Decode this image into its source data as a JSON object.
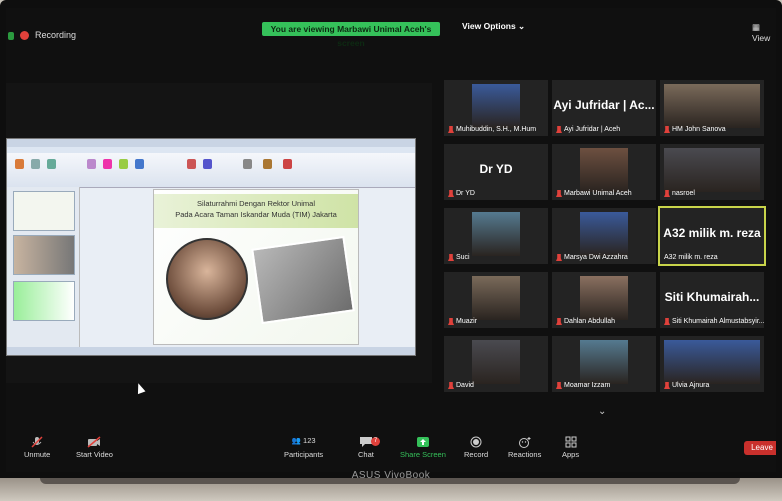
{
  "topbar": {
    "recording": "Recording",
    "banner": "You are viewing Marbawi Unimal Aceh's screen",
    "view_options": "View Options ⌄",
    "view": "View"
  },
  "slide": {
    "line1": "Silaturrahmi Dengan Rektor Unimal",
    "line2": "Pada Acara Taman Iskandar Muda (TIM) Jakarta"
  },
  "gallery": [
    {
      "name": "Muhibuddin, S.H., M.Hum",
      "type": "video"
    },
    {
      "name": "Ayi Jufridar | Aceh",
      "type": "name",
      "big": "Ayi Jufridar | Ac..."
    },
    {
      "name": "HM John Sanova",
      "type": "video"
    },
    {
      "name": "Dr YD",
      "type": "name",
      "big": "Dr YD"
    },
    {
      "name": "Marbawi Unimal Aceh",
      "type": "video"
    },
    {
      "name": "nasroel",
      "type": "video"
    },
    {
      "name": "Suci",
      "type": "video"
    },
    {
      "name": "Marsya Dwi Azzahra",
      "type": "video"
    },
    {
      "name": "A32 milik m. reza",
      "type": "name",
      "big": "A32 milik m. reza"
    },
    {
      "name": "Muazir",
      "type": "video"
    },
    {
      "name": "Dahlan Abdullah",
      "type": "video"
    },
    {
      "name": "Siti Khumairah Almustabsyir...",
      "type": "name",
      "big": "Siti Khumairah..."
    },
    {
      "name": "David",
      "type": "video"
    },
    {
      "name": "Moamar Izzam",
      "type": "video"
    },
    {
      "name": "Ulvia Ajnura",
      "type": "video"
    }
  ],
  "toolbar": {
    "unmute": "Unmute",
    "start_video": "Start Video",
    "participants_count": "123",
    "participants": "Participants",
    "chat": "Chat",
    "chat_badge": "7",
    "share_screen": "Share Screen",
    "record": "Record",
    "reactions": "Reactions",
    "apps": "Apps",
    "leave": "Leave"
  },
  "device": {
    "brand": "ASUS VivoBook"
  },
  "colors": {
    "banner": "#35c15a",
    "leave": "#c9302c",
    "active_speaker": "#c8d44a",
    "muted": "#e0413b"
  }
}
